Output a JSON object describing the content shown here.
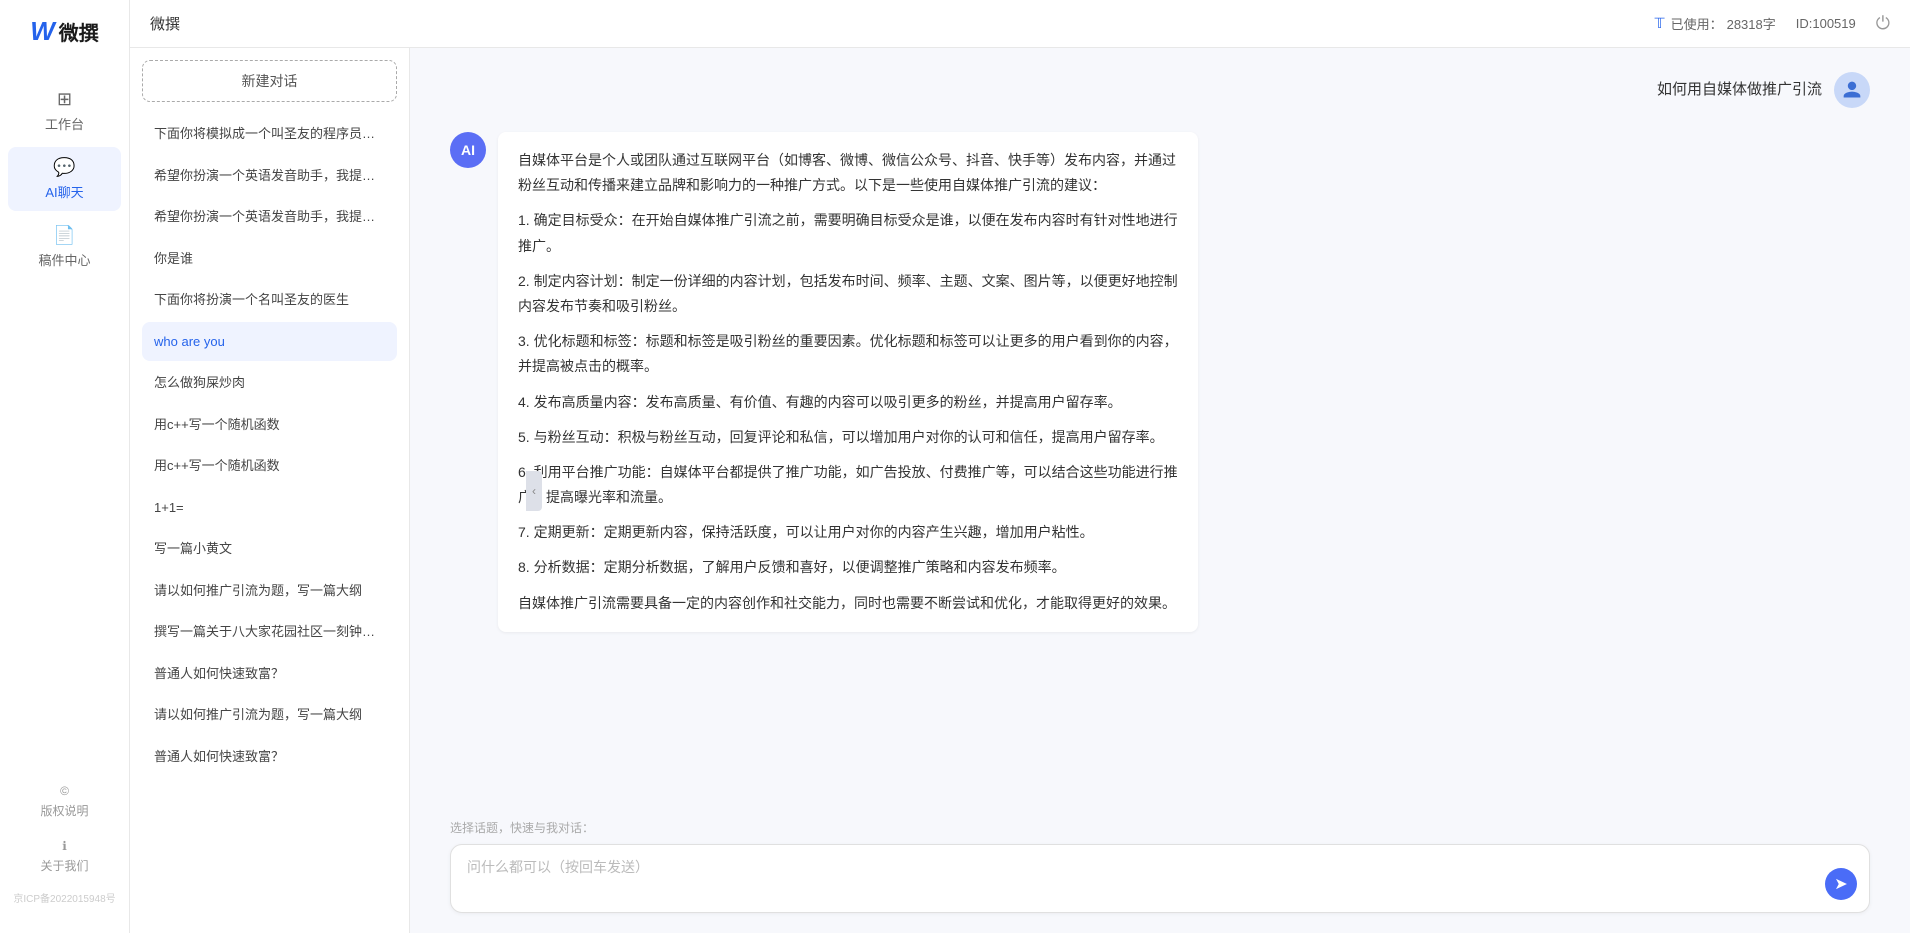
{
  "app": {
    "title": "微撰",
    "logo_letter": "W",
    "logo_name": "微撰"
  },
  "topbar": {
    "title": "微撰",
    "usage_label": "已使用：",
    "usage_count": "28318字",
    "id_label": "ID:100519",
    "power_icon": "⏻"
  },
  "sidebar": {
    "nav_items": [
      {
        "id": "workbench",
        "label": "工作台",
        "icon": "⊞"
      },
      {
        "id": "ai-chat",
        "label": "AI聊天",
        "icon": "💬"
      },
      {
        "id": "drafts",
        "label": "稿件中心",
        "icon": "📄"
      }
    ],
    "footer_items": [
      {
        "id": "copyright",
        "label": "版权说明",
        "icon": "©"
      },
      {
        "id": "about",
        "label": "关于我们",
        "icon": "ℹ"
      }
    ],
    "icp": "京ICP备2022015948号"
  },
  "chat_list": {
    "new_btn": "新建对话",
    "items": [
      {
        "id": 1,
        "text": "下面你将模拟成一个叫圣友的程序员，我说..."
      },
      {
        "id": 2,
        "text": "希望你扮演一个英语发音助手，我提供给你..."
      },
      {
        "id": 3,
        "text": "希望你扮演一个英语发音助手，我提供给你..."
      },
      {
        "id": 4,
        "text": "你是谁"
      },
      {
        "id": 5,
        "text": "下面你将扮演一个名叫圣友的医生"
      },
      {
        "id": 6,
        "text": "who are you",
        "active": true
      },
      {
        "id": 7,
        "text": "怎么做狗屎炒肉"
      },
      {
        "id": 8,
        "text": "用c++写一个随机函数"
      },
      {
        "id": 9,
        "text": "用c++写一个随机函数"
      },
      {
        "id": 10,
        "text": "1+1="
      },
      {
        "id": 11,
        "text": "写一篇小黄文"
      },
      {
        "id": 12,
        "text": "请以如何推广引流为题，写一篇大纲"
      },
      {
        "id": 13,
        "text": "撰写一篇关于八大家花园社区一刻钟便民生..."
      },
      {
        "id": 14,
        "text": "普通人如何快速致富？"
      },
      {
        "id": 15,
        "text": "请以如何推广引流为题，写一篇大纲"
      },
      {
        "id": 16,
        "text": "普通人如何快速致富？"
      }
    ]
  },
  "chat": {
    "user_message": "如何用自媒体做推广引流",
    "ai_response": {
      "intro": "自媒体平台是个人或团队通过互联网平台（如博客、微博、微信公众号、抖音、快手等）发布内容，并通过粉丝互动和传播来建立品牌和影响力的一种推广方式。以下是一些使用自媒体推广引流的建议：",
      "points": [
        "1. 确定目标受众：在开始自媒体推广引流之前，需要明确目标受众是谁，以便在发布内容时有针对性地进行推广。",
        "2. 制定内容计划：制定一份详细的内容计划，包括发布时间、频率、主题、文案、图片等，以便更好地控制内容发布节奏和吸引粉丝。",
        "3. 优化标题和标签：标题和标签是吸引粉丝的重要因素。优化标题和标签可以让更多的用户看到你的内容，并提高被点击的概率。",
        "4. 发布高质量内容：发布高质量、有价值、有趣的内容可以吸引更多的粉丝，并提高用户留存率。",
        "5. 与粉丝互动：积极与粉丝互动，回复评论和私信，可以增加用户对你的认可和信任，提高用户留存率。",
        "6. 利用平台推广功能：自媒体平台都提供了推广功能，如广告投放、付费推广等，可以结合这些功能进行推广，提高曝光率和流量。",
        "7. 定期更新：定期更新内容，保持活跃度，可以让用户对你的内容产生兴趣，增加用户粘性。",
        "8. 分析数据：定期分析数据，了解用户反馈和喜好，以便调整推广策略和内容发布频率。"
      ],
      "conclusion": "自媒体推广引流需要具备一定的内容创作和社交能力，同时也需要不断尝试和优化，才能取得更好的效果。"
    },
    "input_placeholder": "问什么都可以（按回车发送）",
    "quick_topic_label": "选择话题，快速与我对话：",
    "send_icon": "➤"
  }
}
